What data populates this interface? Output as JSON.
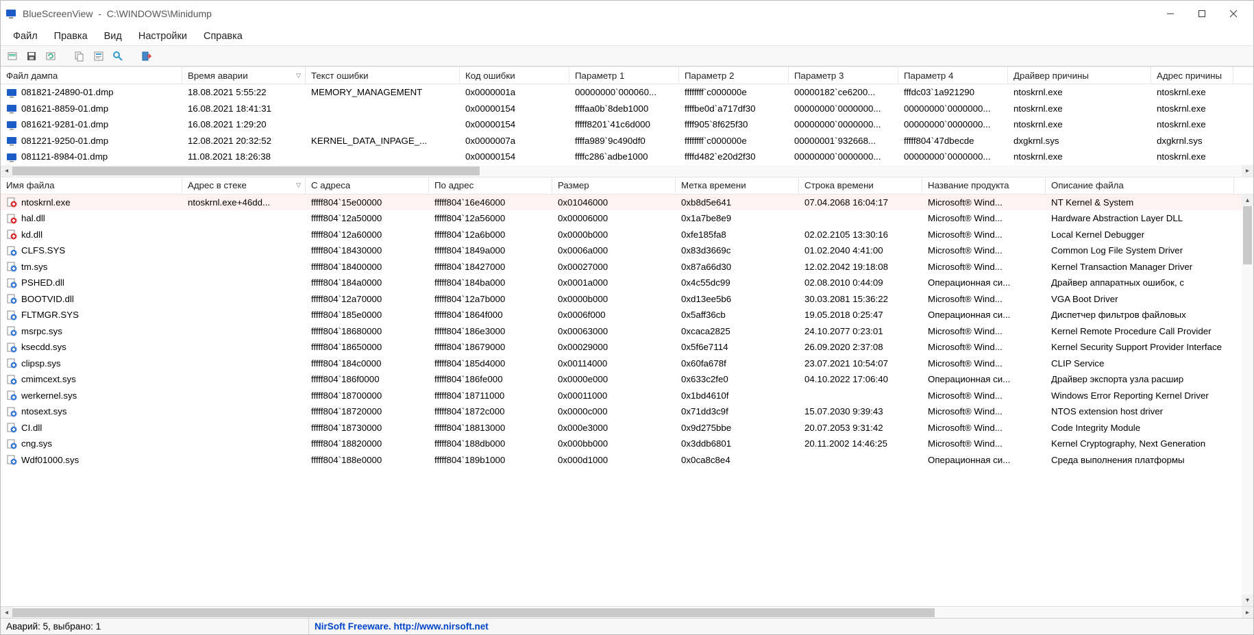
{
  "titlebar": {
    "app_name": "BlueScreenView",
    "path": "C:\\WINDOWS\\Minidump"
  },
  "menu": [
    "Файл",
    "Правка",
    "Вид",
    "Настройки",
    "Справка"
  ],
  "top_table": {
    "headers": [
      "Файл дампа",
      "Время аварии",
      "Текст ошибки",
      "Код ошибки",
      "Параметр 1",
      "Параметр 2",
      "Параметр 3",
      "Параметр 4",
      "Драйвер причины",
      "Адрес причины"
    ],
    "sorted_col": 1,
    "widths": [
      265,
      180,
      225,
      160,
      160,
      160,
      160,
      160,
      209,
      120
    ],
    "rows": [
      {
        "cells": [
          "081821-24890-01.dmp",
          "18.08.2021 5:55:22",
          "MEMORY_MANAGEMENT",
          "0x0000001a",
          "00000000`000060...",
          "ffffffff`c000000e",
          "00000182`ce6200...",
          "fffdc03`1a921290",
          "ntoskrnl.exe",
          "ntoskrnl.exe"
        ]
      },
      {
        "cells": [
          "081621-8859-01.dmp",
          "16.08.2021 18:41:31",
          "",
          "0x00000154",
          "ffffaa0b`8deb1000",
          "ffffbe0d`a717df30",
          "00000000`0000000...",
          "00000000`0000000...",
          "ntoskrnl.exe",
          "ntoskrnl.exe"
        ]
      },
      {
        "cells": [
          "081621-9281-01.dmp",
          "16.08.2021 1:29:20",
          "",
          "0x00000154",
          "fffff8201`41c6d000",
          "ffff905`8f625f30",
          "00000000`0000000...",
          "00000000`0000000...",
          "ntoskrnl.exe",
          "ntoskrnl.exe"
        ]
      },
      {
        "cells": [
          "081221-9250-01.dmp",
          "12.08.2021 20:32:52",
          "KERNEL_DATA_INPAGE_...",
          "0x0000007a",
          "ffffa989`9c490df0",
          "ffffffff`c000000e",
          "00000001`932668...",
          "fffff804`47dbecde",
          "dxgkrnl.sys",
          "dxgkrnl.sys"
        ]
      },
      {
        "cells": [
          "081121-8984-01.dmp",
          "11.08.2021 18:26:38",
          "",
          "0x00000154",
          "ffffc286`adbe1000",
          "ffffd482`e20d2f30",
          "00000000`0000000...",
          "00000000`0000000...",
          "ntoskrnl.exe",
          "ntoskrnl.exe"
        ]
      }
    ]
  },
  "bottom_table": {
    "headers": [
      "Имя файла",
      "Адрес в стеке",
      "С адреса",
      "По адрес",
      "Размер",
      "Метка времени",
      "Строка времени",
      "Название продукта",
      "Описание файла"
    ],
    "sorted_col": 1,
    "widths": [
      265,
      180,
      180,
      180,
      180,
      180,
      180,
      180,
      275
    ],
    "rows": [
      {
        "sel": true,
        "hl": true,
        "cells": [
          "ntoskrnl.exe",
          "ntoskrnl.exe+46dd...",
          "fffff804`15e00000",
          "fffff804`16e46000",
          "0x01046000",
          "0xb8d5e641",
          "07.04.2068 16:04:17",
          "Microsoft® Wind...",
          "NT Kernel & System"
        ]
      },
      {
        "hl": true,
        "cells": [
          "hal.dll",
          "",
          "fffff804`12a50000",
          "fffff804`12a56000",
          "0x00006000",
          "0x1a7be8e9",
          "",
          "Microsoft® Wind...",
          "Hardware Abstraction Layer DLL"
        ]
      },
      {
        "hl": true,
        "cells": [
          "kd.dll",
          "",
          "fffff804`12a60000",
          "fffff804`12a6b000",
          "0x0000b000",
          "0xfe185fa8",
          "02.02.2105 13:30:16",
          "Microsoft® Wind...",
          "Local Kernel Debugger"
        ]
      },
      {
        "cells": [
          "CLFS.SYS",
          "",
          "fffff804`18430000",
          "fffff804`1849a000",
          "0x0006a000",
          "0x83d3669c",
          "01.02.2040 4:41:00",
          "Microsoft® Wind...",
          "Common Log File System Driver"
        ]
      },
      {
        "cells": [
          "tm.sys",
          "",
          "fffff804`18400000",
          "fffff804`18427000",
          "0x00027000",
          "0x87a66d30",
          "12.02.2042 19:18:08",
          "Microsoft® Wind...",
          "Kernel Transaction Manager Driver"
        ]
      },
      {
        "cells": [
          "PSHED.dll",
          "",
          "fffff804`184a0000",
          "fffff804`184ba000",
          "0x0001a000",
          "0x4c55dc99",
          "02.08.2010 0:44:09",
          "Операционная си...",
          "Драйвер аппаратных ошибок, с"
        ]
      },
      {
        "cells": [
          "BOOTVID.dll",
          "",
          "fffff804`12a70000",
          "fffff804`12a7b000",
          "0x0000b000",
          "0xd13ee5b6",
          "30.03.2081 15:36:22",
          "Microsoft® Wind...",
          "VGA Boot Driver"
        ]
      },
      {
        "cells": [
          "FLTMGR.SYS",
          "",
          "fffff804`185e0000",
          "fffff804`1864f000",
          "0x0006f000",
          "0x5aff36cb",
          "19.05.2018 0:25:47",
          "Операционная си...",
          "Диспетчер фильтров файловых"
        ]
      },
      {
        "cells": [
          "msrpc.sys",
          "",
          "fffff804`18680000",
          "fffff804`186e3000",
          "0x00063000",
          "0xcaca2825",
          "24.10.2077 0:23:01",
          "Microsoft® Wind...",
          "Kernel Remote Procedure Call Provider"
        ]
      },
      {
        "cells": [
          "ksecdd.sys",
          "",
          "fffff804`18650000",
          "fffff804`18679000",
          "0x00029000",
          "0x5f6e7114",
          "26.09.2020 2:37:08",
          "Microsoft® Wind...",
          "Kernel Security Support Provider Interface"
        ]
      },
      {
        "cells": [
          "clipsp.sys",
          "",
          "fffff804`184c0000",
          "fffff804`185d4000",
          "0x00114000",
          "0x60fa678f",
          "23.07.2021 10:54:07",
          "Microsoft® Wind...",
          "CLIP Service"
        ]
      },
      {
        "cells": [
          "cmimcext.sys",
          "",
          "fffff804`186f0000",
          "fffff804`186fe000",
          "0x0000e000",
          "0x633c2fe0",
          "04.10.2022 17:06:40",
          "Операционная си...",
          "Драйвер экспорта узла расшир"
        ]
      },
      {
        "cells": [
          "werkernel.sys",
          "",
          "fffff804`18700000",
          "fffff804`18711000",
          "0x00011000",
          "0x1bd4610f",
          "",
          "Microsoft® Wind...",
          "Windows Error Reporting Kernel Driver"
        ]
      },
      {
        "cells": [
          "ntosext.sys",
          "",
          "fffff804`18720000",
          "fffff804`1872c000",
          "0x0000c000",
          "0x71dd3c9f",
          "15.07.2030 9:39:43",
          "Microsoft® Wind...",
          "NTOS extension host driver"
        ]
      },
      {
        "cells": [
          "CI.dll",
          "",
          "fffff804`18730000",
          "fffff804`18813000",
          "0x000e3000",
          "0x9d275bbe",
          "20.07.2053 9:31:42",
          "Microsoft® Wind...",
          "Code Integrity Module"
        ]
      },
      {
        "cells": [
          "cng.sys",
          "",
          "fffff804`18820000",
          "fffff804`188db000",
          "0x000bb000",
          "0x3ddb6801",
          "20.11.2002 14:46:25",
          "Microsoft® Wind...",
          "Kernel Cryptography, Next Generation"
        ]
      },
      {
        "cells": [
          "Wdf01000.sys",
          "",
          "fffff804`188e0000",
          "fffff804`189b1000",
          "0x000d1000",
          "0x0ca8c8e4",
          "",
          "Операционная си...",
          "Среда выполнения платформы"
        ]
      }
    ]
  },
  "status": {
    "left": "Аварий: 5, выбрано: 1",
    "right": "NirSoft Freeware.  http://www.nirsoft.net"
  }
}
